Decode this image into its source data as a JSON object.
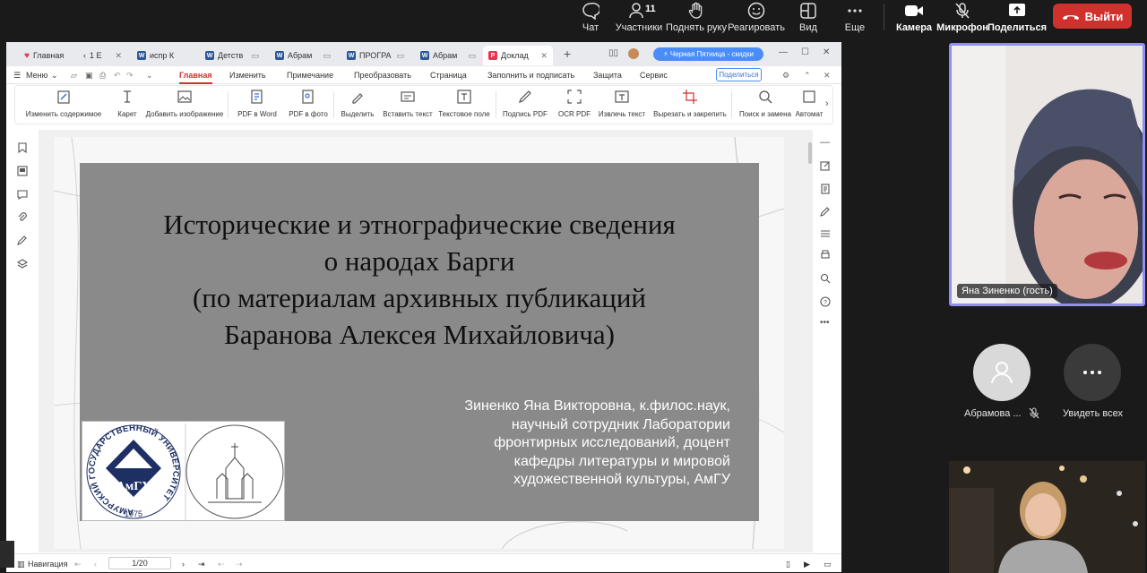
{
  "meeting_toolbar": {
    "chat": "Чат",
    "participants": "Участники",
    "participants_count": "11",
    "raise_hand": "Поднять руку",
    "react": "Реагировать",
    "view": "Вид",
    "more": "Еще",
    "camera": "Камера",
    "microphone": "Микрофон",
    "share": "Поделиться",
    "leave": "Выйти"
  },
  "tabs": [
    {
      "label": "Главная"
    },
    {
      "label": "1 Е"
    },
    {
      "label": "испр К"
    },
    {
      "label": "Детств"
    },
    {
      "label": "Абрам"
    },
    {
      "label": "ПРОГРА"
    },
    {
      "label": "Абрам"
    },
    {
      "label": "Доклад"
    }
  ],
  "promo": "Черная Пятница - скидки",
  "menu": {
    "menu_label": "Меню",
    "items": [
      "Главная",
      "Изменить",
      "Примечание",
      "Преобразовать",
      "Страница",
      "Заполнить и подписать",
      "Защита",
      "Сервис"
    ],
    "share_button": "Поделиться"
  },
  "ribbon": [
    "Изменить содержимое",
    "Карет",
    "Добавить изображение",
    "PDF в Word",
    "PDF в фото",
    "Выделить",
    "Вставить текст",
    "Текстовое поле",
    "Подпись PDF",
    "OCR PDF",
    "Извлечь текст",
    "Вырезать и закрепить",
    "Поиск и замена",
    "Автомат"
  ],
  "slide": {
    "title_lines": [
      "Исторические и этнографические сведения",
      "о народах Барги",
      "(по материалам архивных публикаций",
      "Баранова Алексея Михайловича)"
    ],
    "author_lines": [
      "Зиненко Яна Викторовна, к.филос.наук,",
      "научный сотрудник Лаборатории",
      "фронтирных исследований, доцент",
      "кафедры литературы и мировой",
      "художественной культуры, АмГУ"
    ],
    "logo_ring_text": "АМУРСКИЙ ГОСУДАРСТВЕННЫЙ УНИВЕРСИТЕТ",
    "logo_abbr": "АмГУ",
    "logo_year": "1975"
  },
  "status": {
    "navigation": "Навигация",
    "page_indicator": "1/20"
  },
  "participants": {
    "speaker_name": "Яна Зиненко (гость)",
    "participant2_name": "Абрамова ...",
    "see_all": "Увидеть всех"
  },
  "colors": {
    "leave_button": "#d0312d",
    "active_speaker_border": "#8f8ff5",
    "promo": "#4b8df8",
    "active_menu": "#d0312d"
  }
}
